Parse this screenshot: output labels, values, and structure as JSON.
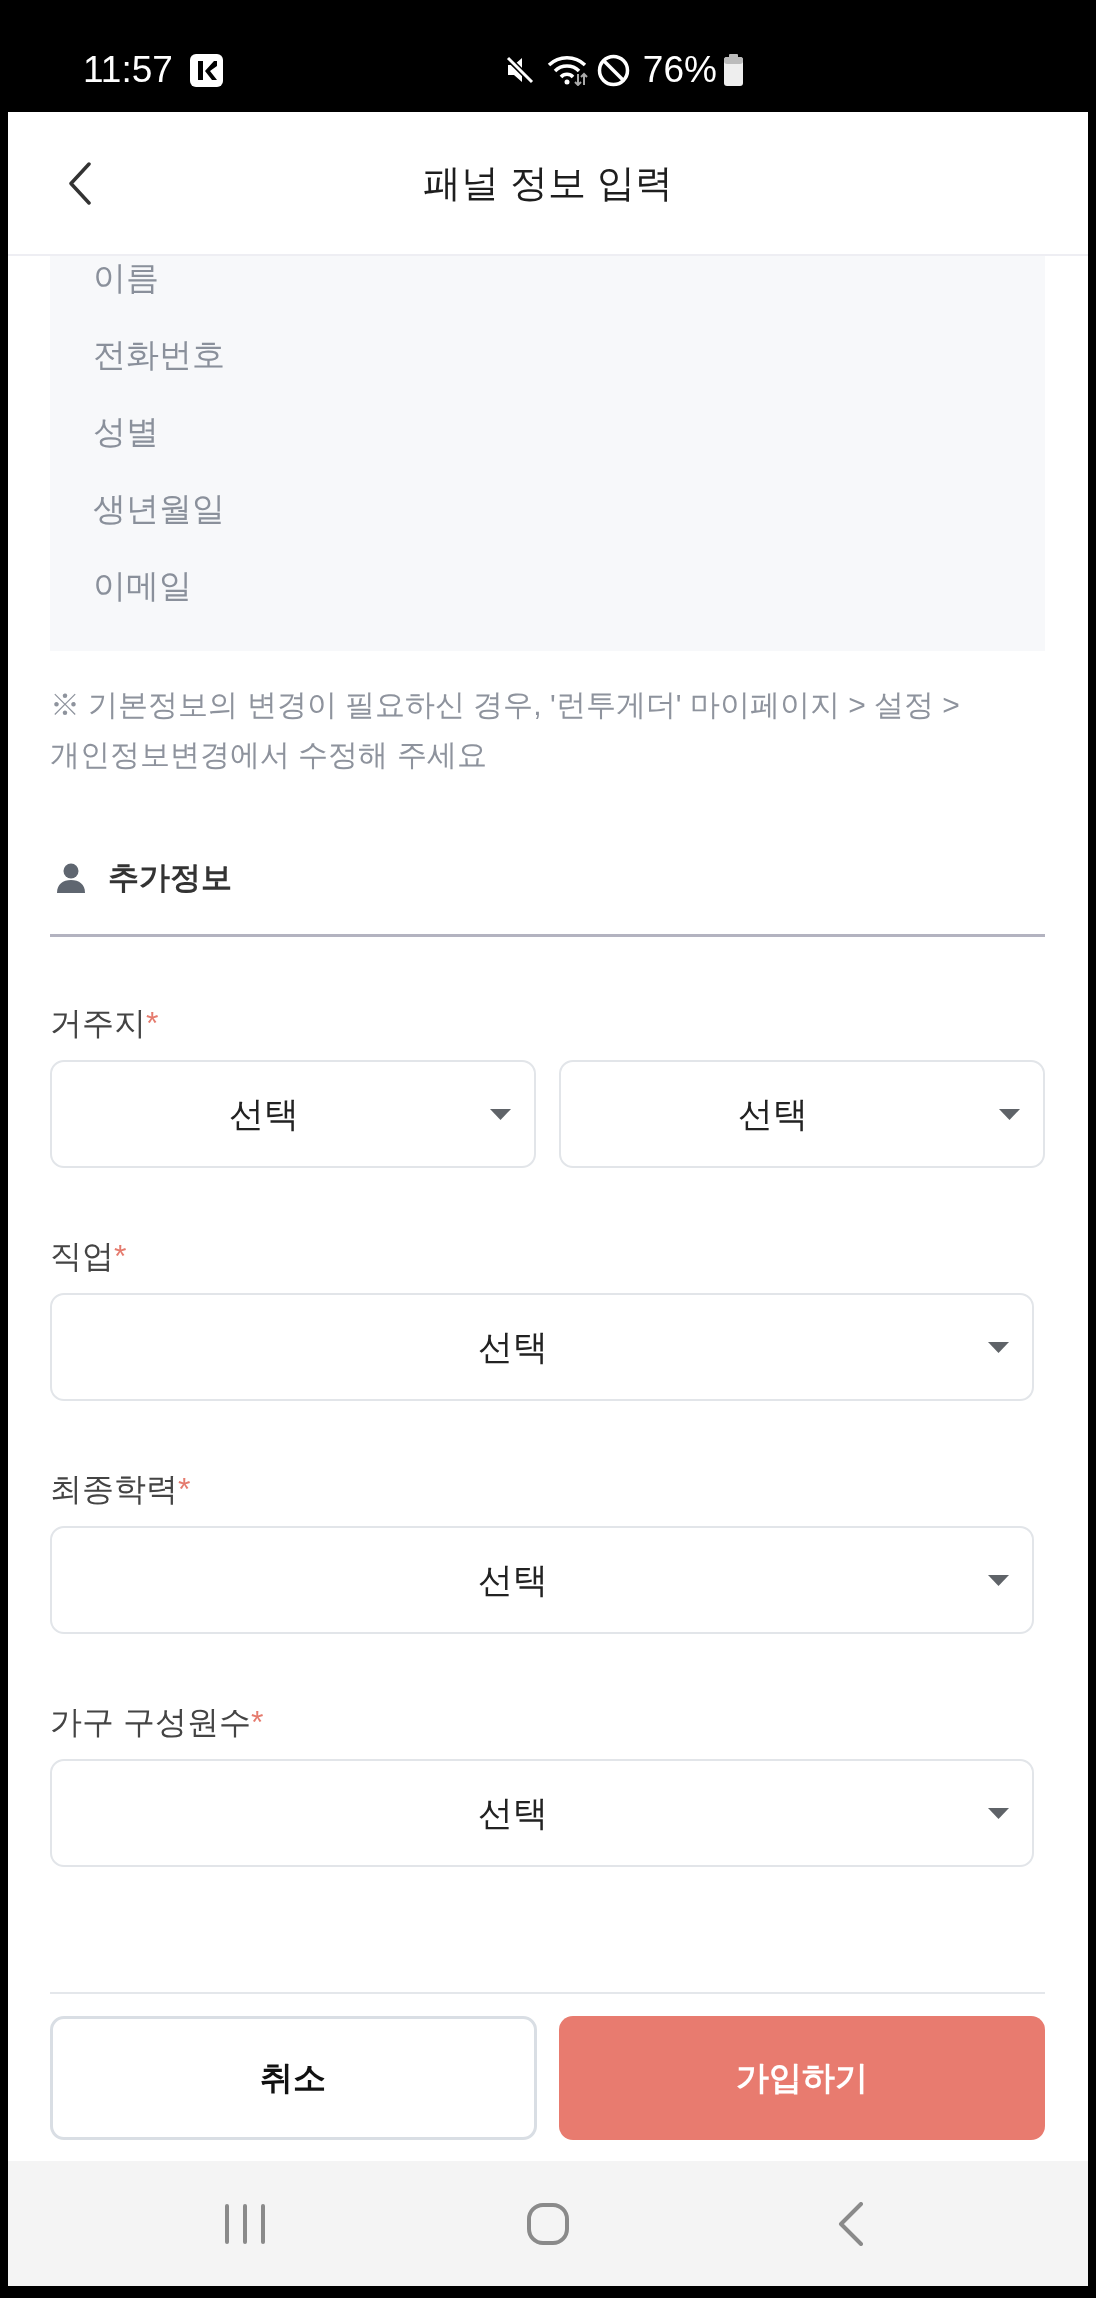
{
  "status_bar": {
    "time": "11:57",
    "battery": "76%"
  },
  "header": {
    "title": "패널 정보 입력"
  },
  "basic_info": {
    "items": [
      "이름",
      "전화번호",
      "성별",
      "생년월일",
      "이메일"
    ],
    "note": "※ 기본정보의 변경이 필요하신 경우, '런투게더' 마이페이지 > 설정 > 개인정보변경에서 수정해 주세요"
  },
  "additional_info": {
    "title": "추가정보",
    "fields": [
      {
        "label": "거주지",
        "required_mark": "*",
        "selects": [
          {
            "value": "선택"
          },
          {
            "value": "선택"
          }
        ]
      },
      {
        "label": "직업",
        "required_mark": "*",
        "selects": [
          {
            "value": "선택"
          }
        ]
      },
      {
        "label": "최종학력",
        "required_mark": "*",
        "selects": [
          {
            "value": "선택"
          }
        ]
      },
      {
        "label": "가구 구성원수",
        "required_mark": "*",
        "selects": [
          {
            "value": "선택"
          }
        ]
      }
    ]
  },
  "buttons": [
    {
      "label": "취소",
      "kind": "secondary"
    },
    {
      "label": "가입하기",
      "kind": "primary"
    }
  ]
}
